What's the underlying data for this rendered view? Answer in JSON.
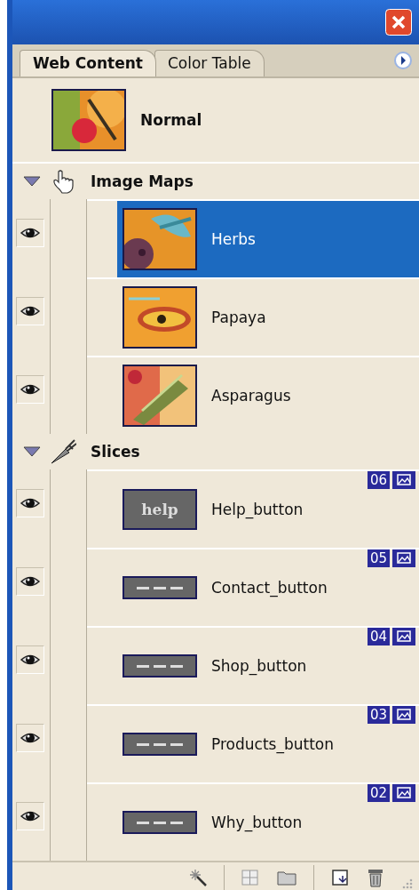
{
  "tabs": [
    {
      "label": "Web Content",
      "selected": true
    },
    {
      "label": "Color Table",
      "selected": false
    }
  ],
  "normal": {
    "label": "Normal"
  },
  "groups": [
    {
      "label": "Image Maps",
      "kind": "image_maps",
      "expanded": true,
      "items": [
        {
          "name": "Herbs",
          "visible": true,
          "selected": true
        },
        {
          "name": "Papaya",
          "visible": true,
          "selected": false
        },
        {
          "name": "Asparagus",
          "visible": true,
          "selected": false
        }
      ]
    },
    {
      "label": "Slices",
      "kind": "slices",
      "expanded": true,
      "items": [
        {
          "name": "Help_button",
          "number": "06",
          "visible": true,
          "selected": false,
          "thumb_label": "help"
        },
        {
          "name": "Contact_button",
          "number": "05",
          "visible": true,
          "selected": false
        },
        {
          "name": "Shop_button",
          "number": "04",
          "visible": true,
          "selected": false
        },
        {
          "name": "Products_button",
          "number": "03",
          "visible": true,
          "selected": false
        },
        {
          "name": "Why_button",
          "number": "02",
          "visible": true,
          "selected": false
        }
      ]
    }
  ]
}
